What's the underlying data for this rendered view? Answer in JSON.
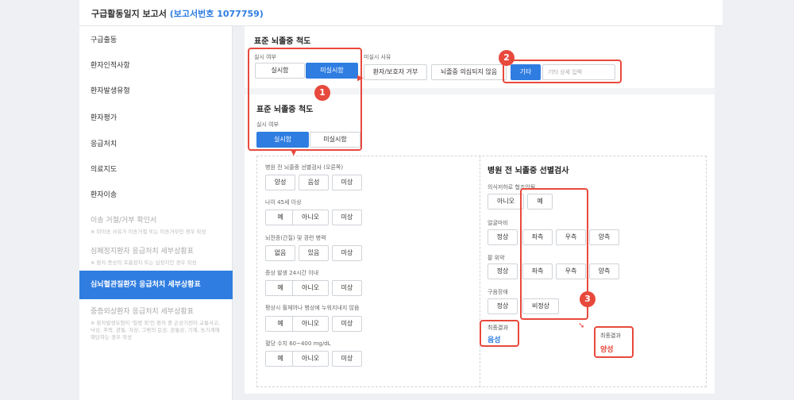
{
  "header": {
    "title": "구급활동일지 보고서",
    "report_no": "(보고서번호 1077759)"
  },
  "sidebar": {
    "items": [
      {
        "label": "구급출동"
      },
      {
        "label": "환자인적사항"
      },
      {
        "label": "환자발생유형"
      },
      {
        "label": "환자평가"
      },
      {
        "label": "응급처치"
      },
      {
        "label": "의료지도"
      },
      {
        "label": "환자이송"
      },
      {
        "label": "이송 거절/거부 확인서",
        "sub": "※ 미이송 사유가 이송거절 또는 이송거부인 경우 작성"
      },
      {
        "label": "심폐정지환자 응급처치 세부상황표",
        "sub": "※ 환자 증상의 호흡정지 또는 심정지인 경우 작성"
      },
      {
        "label": "심뇌혈관질환자 응급처치 세부상황표"
      },
      {
        "label": "중증외상환자 응급처치 세부상황표",
        "sub": "※ 환자발생유형이 '질병 외'인 환자 중 손상기전이 교통사고, 낙상, 추락, 관통, 자상, 그밖의 둔상, 관통상, 기계, 농기계에 해당하는 경우 작성"
      }
    ]
  },
  "top_section": {
    "title": "표준 뇌졸중 척도",
    "exec_label": "실시 여부",
    "exec_options": [
      "실시함",
      "미실시함"
    ],
    "reason_label": "미실시 사유",
    "reason_options": [
      "환자/보호자 거부",
      "뇌졸중 의심되지 않음",
      "기타"
    ],
    "reason_placeholder": "기타 상세 입력"
  },
  "second_section": {
    "title": "표준 뇌졸중 척도",
    "exec_label": "실시 여부",
    "exec_options": [
      "실시함",
      "미실시함"
    ]
  },
  "left_questions": [
    {
      "label": "병원 전 뇌졸중 선별검사 (오른쪽)",
      "options": [
        "양성",
        "음성",
        "미상"
      ]
    },
    {
      "label": "나이 45세 이상",
      "options": [
        "예",
        "아니오",
        "미상"
      ]
    },
    {
      "label": "뇌전증(간질) 및 경련 병력",
      "options": [
        "없음",
        "있음",
        "미상"
      ]
    },
    {
      "label": "증상 발생 24시간 이내",
      "options": [
        "예",
        "아니오",
        "미상"
      ]
    },
    {
      "label": "평상시 휠체어나 병상에 누워지내지 않음",
      "options": [
        "예",
        "아니오",
        "미상"
      ]
    },
    {
      "label": "혈당 수치 60~400 mg/dL",
      "options": [
        "예",
        "아니오",
        "미상"
      ]
    }
  ],
  "right_panel": {
    "title": "병원 전 뇌졸중 선별검사",
    "q1": {
      "label": "의식저하로 협조안됨",
      "options": [
        "아니오",
        "예"
      ]
    },
    "q2": {
      "label": "얼굴마비",
      "options": [
        "정상",
        "좌측",
        "우측",
        "양측"
      ]
    },
    "q3": {
      "label": "팔 위약",
      "options": [
        "정상",
        "좌측",
        "우측",
        "양측"
      ]
    },
    "q4": {
      "label": "구음장애",
      "options": [
        "정상",
        "비정상"
      ]
    },
    "result_label": "최종결과",
    "result_negative": "음성",
    "result_positive": "양성"
  },
  "badges": [
    "1",
    "2",
    "3"
  ],
  "colors": {
    "accent": "#2f7de1",
    "highlight": "#e8493d",
    "positive": "#e8493d",
    "negative": "#2f7de1"
  }
}
